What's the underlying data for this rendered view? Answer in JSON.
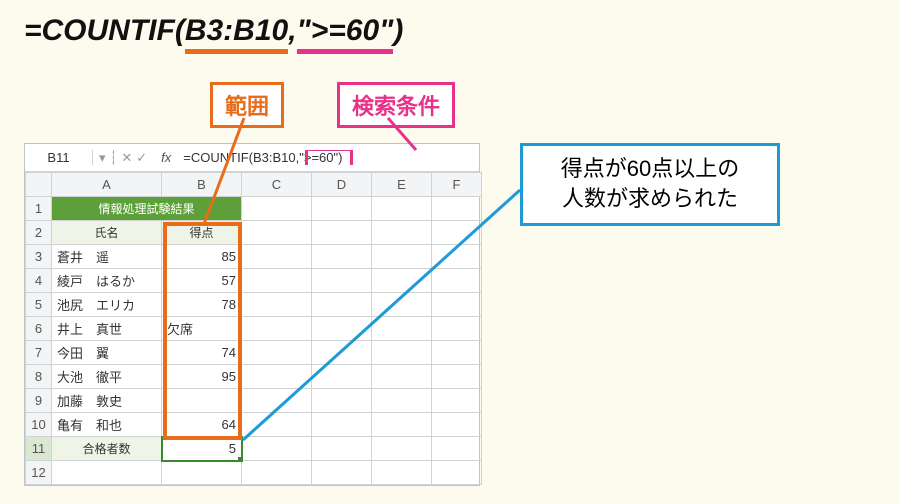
{
  "formula": {
    "eq": "=COUNTIF(",
    "range": "B3:B10",
    "sep": ",",
    "cond": "\">=60\"",
    "close": ")"
  },
  "labels": {
    "range": "範囲",
    "cond": "検索条件"
  },
  "callout": {
    "line1": "得点が60点以上の",
    "line2": "人数が求められた"
  },
  "sheet": {
    "active_cell": "B11",
    "fx_label": "fx",
    "formula_bar": "=COUNTIF(B3:B10,\">=60\")",
    "col_headers": [
      "A",
      "B",
      "C",
      "D",
      "E",
      "F"
    ],
    "title": "情報処理試験結果",
    "sub_name": "氏名",
    "sub_score": "得点",
    "rows": [
      {
        "n": "3",
        "name": "蒼井　遥",
        "score": "85"
      },
      {
        "n": "4",
        "name": "綾戸　はるか",
        "score": "57"
      },
      {
        "n": "5",
        "name": "池尻　エリカ",
        "score": "78"
      },
      {
        "n": "6",
        "name": "井上　真世",
        "score": "欠席"
      },
      {
        "n": "7",
        "name": "今田　翼",
        "score": "74"
      },
      {
        "n": "8",
        "name": "大池　徹平",
        "score": "95"
      },
      {
        "n": "9",
        "name": "加藤　敦史",
        "score": ""
      },
      {
        "n": "10",
        "name": "亀有　和也",
        "score": "64"
      }
    ],
    "summary_label": "合格者数",
    "summary_value": "5"
  }
}
